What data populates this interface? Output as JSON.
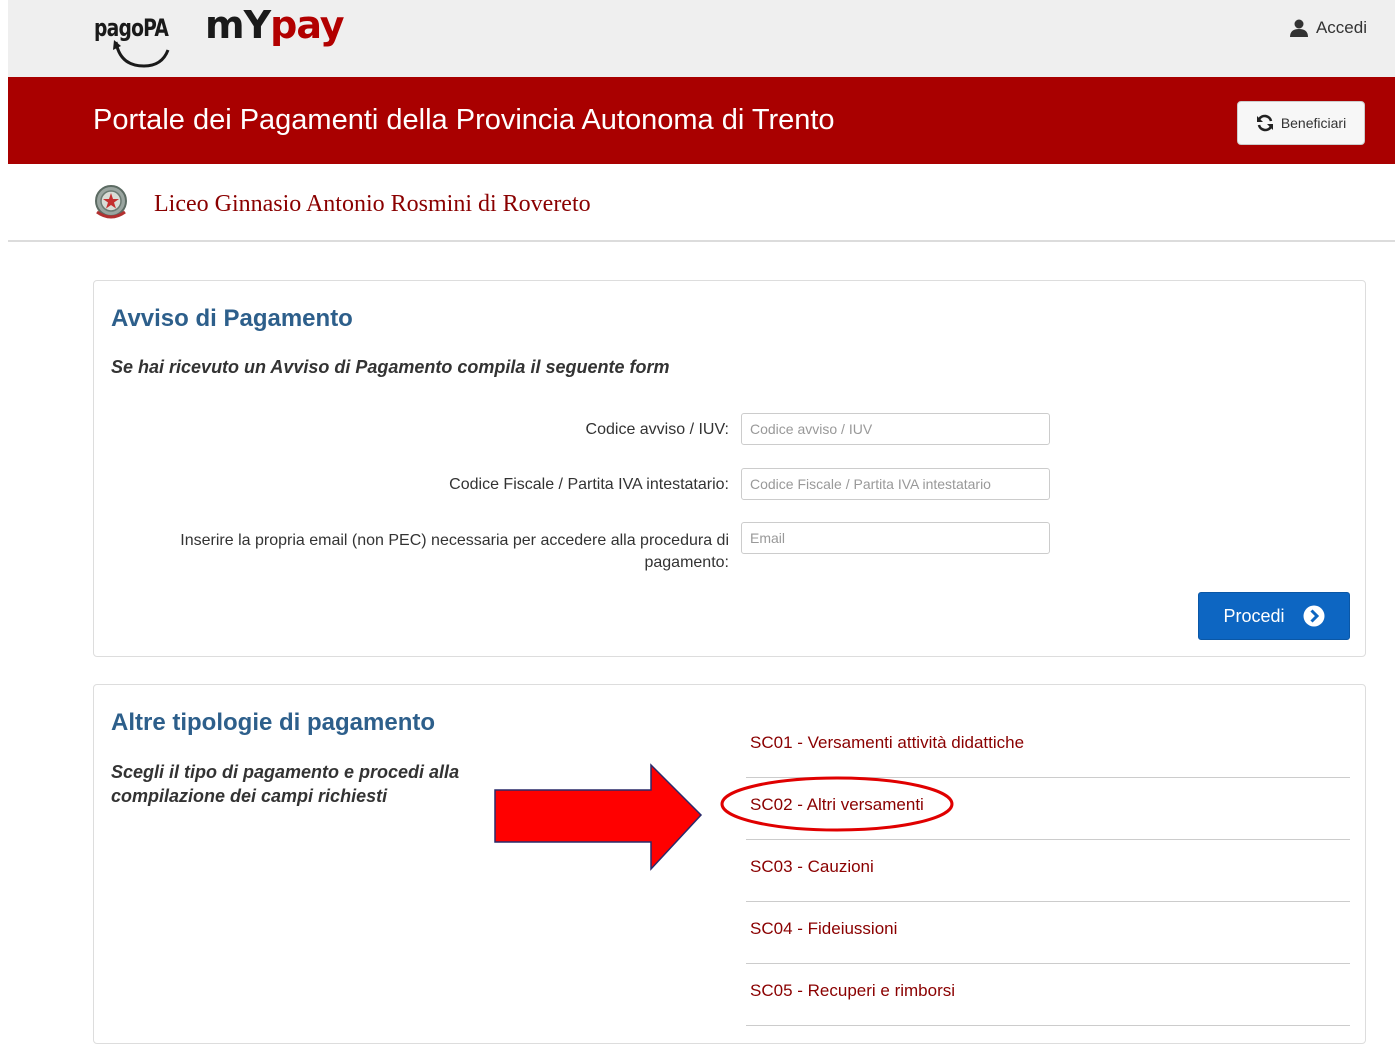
{
  "header": {
    "logo_pagopa": "pagoPA",
    "logo_my": "mY",
    "logo_pay": "pay",
    "login_label": "Accedi"
  },
  "banner": {
    "title": "Portale dei Pagamenti della Provincia Autonoma di Trento",
    "beneficiari_label": "Beneficiari"
  },
  "org": {
    "name": "Liceo Ginnasio Antonio Rosmini di Rovereto"
  },
  "avviso": {
    "title": "Avviso di Pagamento",
    "subtitle": "Se hai ricevuto un Avviso di Pagamento compila il seguente form",
    "fields": [
      {
        "label": "Codice avviso / IUV:",
        "placeholder": "Codice avviso / IUV",
        "value": ""
      },
      {
        "label": "Codice Fiscale / Partita IVA intestatario:",
        "placeholder": "Codice Fiscale / Partita IVA intestatario",
        "value": ""
      },
      {
        "label_line1": "Inserire la propria email (non PEC) necessaria per accedere alla procedura di",
        "label_line2": "pagamento:",
        "placeholder": "Email",
        "value": ""
      }
    ],
    "submit_label": "Procedi"
  },
  "altre": {
    "title": "Altre tipologie di pagamento",
    "subtitle_line1": "Scegli il tipo di pagamento e procedi alla",
    "subtitle_line2": "compilazione dei campi richiesti",
    "items": [
      "SC01 - Versamenti attività didattiche",
      "SC02 - Altri versamenti",
      "SC03 - Cauzioni",
      "SC04 - Fideiussioni",
      "SC05 - Recuperi e rimborsi"
    ]
  },
  "annotation": {
    "arrow_color": "#ff0000",
    "highlight_color": "#e00000"
  }
}
